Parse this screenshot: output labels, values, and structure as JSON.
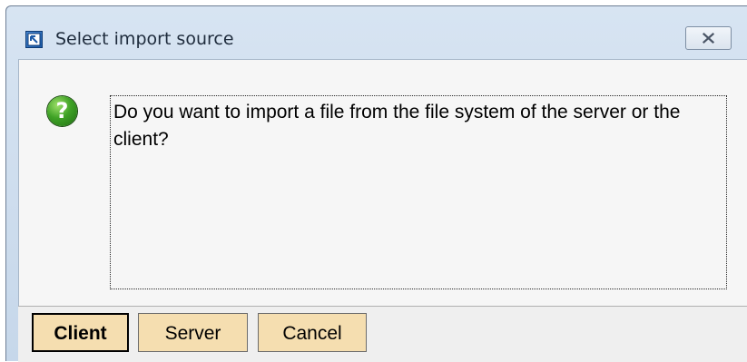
{
  "window": {
    "title": "Select import source",
    "close_icon": "close-x-icon",
    "app_icon": "app-window-icon"
  },
  "dialog": {
    "icon": "question-icon",
    "icon_glyph": "?",
    "message": "Do you want to import a file from the file system of the server or the client?"
  },
  "buttons": {
    "client": "Client",
    "server": "Server",
    "cancel": "Cancel"
  },
  "colors": {
    "button_bg": "#f5deb0",
    "question_icon": "#3fa226",
    "titlebar": "#d7e4f2"
  }
}
